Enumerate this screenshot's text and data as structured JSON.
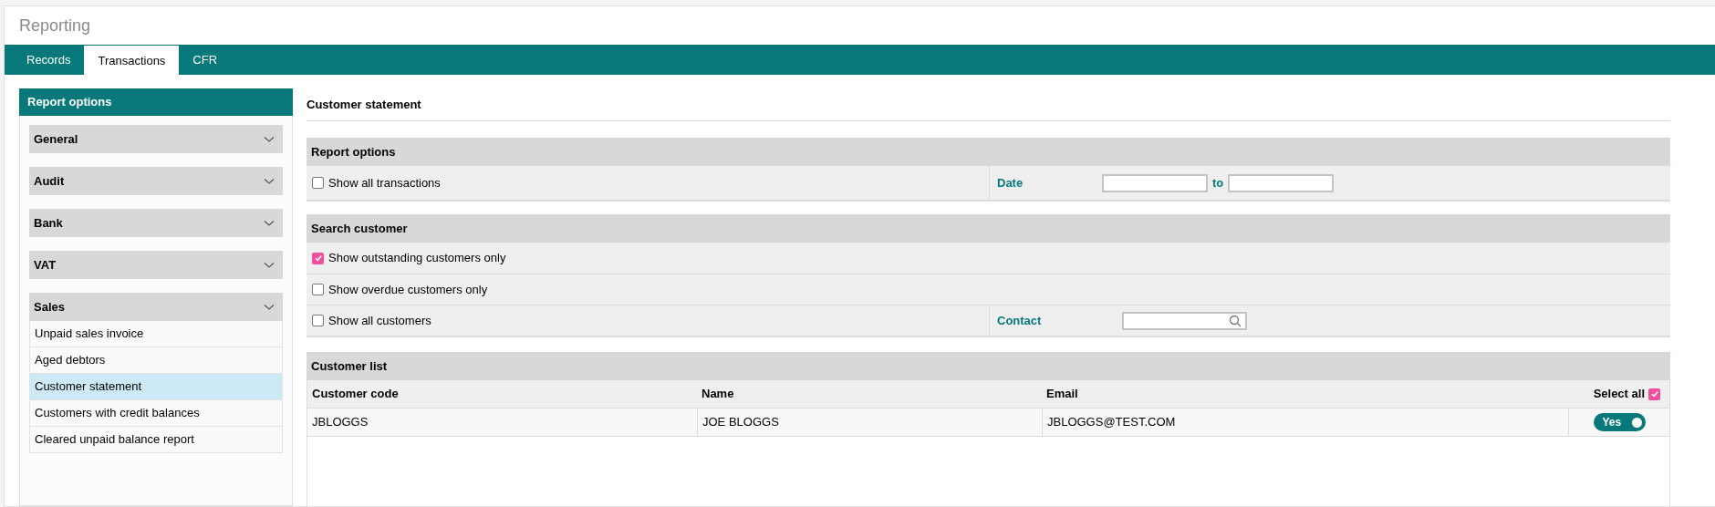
{
  "window": {
    "title": "Reporting"
  },
  "tabs": [
    {
      "label": "Records",
      "selected": false
    },
    {
      "label": "Transactions",
      "selected": true
    },
    {
      "label": "CFR",
      "selected": false
    }
  ],
  "sidebar": {
    "title": "Report options",
    "groups": [
      {
        "label": "General"
      },
      {
        "label": "Audit"
      },
      {
        "label": "Bank"
      },
      {
        "label": "VAT"
      },
      {
        "label": "Sales",
        "items": [
          {
            "label": "Unpaid sales invoice",
            "selected": false
          },
          {
            "label": "Aged debtors",
            "selected": false
          },
          {
            "label": "Customer statement",
            "selected": true
          },
          {
            "label": "Customers with credit balances",
            "selected": false
          },
          {
            "label": "Cleared unpaid balance report",
            "selected": false
          }
        ]
      }
    ]
  },
  "page_title": "Customer statement",
  "report_options": {
    "title": "Report options",
    "option": {
      "label": "Show all transactions",
      "checked": false
    },
    "date_label": "Date",
    "to_label": "to"
  },
  "search_customer": {
    "title": "Search customer",
    "options": [
      {
        "label": "Show outstanding customers only",
        "checked": true
      },
      {
        "label": "Show overdue customers only",
        "checked": false
      },
      {
        "label": "Show all customers",
        "checked": false
      }
    ],
    "contact_label": "Contact"
  },
  "customer_list": {
    "title": "Customer list",
    "columns": [
      "Customer code",
      "Name",
      "Email",
      "Select all"
    ],
    "select_all_checked": true,
    "rows": [
      {
        "code": "JBLOGGS",
        "name": "JOE BLOGGS",
        "email": "JBLOGGS@TEST.COM",
        "toggle": {
          "label": "Yes",
          "on": true
        }
      }
    ]
  }
}
